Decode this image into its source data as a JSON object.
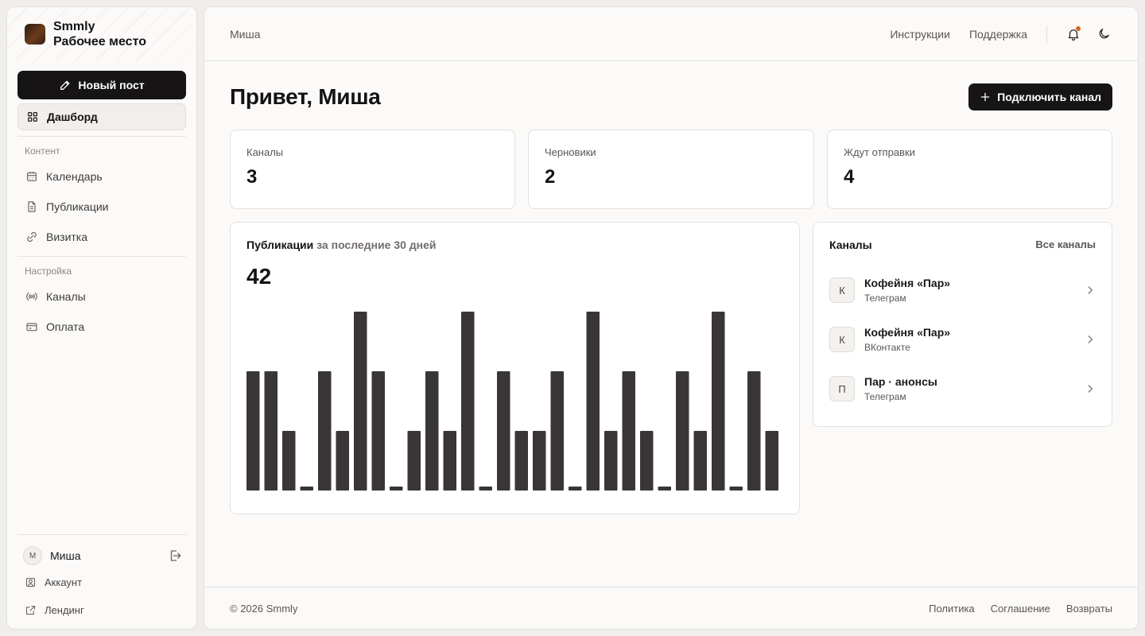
{
  "sidebar": {
    "brand_name": "Smmly",
    "brand_sub": "Рабочее место",
    "new_post": "Новый пост",
    "dashboard": "Дашборд",
    "section_content": "Контент",
    "calendar": "Календарь",
    "publications": "Публикации",
    "card": "Визитка",
    "section_settings": "Настройка",
    "channels": "Каналы",
    "payment": "Оплата",
    "user_initial": "М",
    "user_name": "Миша",
    "account": "Аккаунт",
    "landing": "Лендинг"
  },
  "topbar": {
    "breadcrumb": "Миша",
    "instructions": "Инструкции",
    "support": "Поддержка"
  },
  "main": {
    "greeting": "Привет, Миша",
    "connect_channel": "Подключить канал",
    "stats": [
      {
        "label": "Каналы",
        "value": "3"
      },
      {
        "label": "Черновики",
        "value": "2"
      },
      {
        "label": "Ждут отправки",
        "value": "4"
      }
    ],
    "chart_title": "Публикации",
    "chart_subtitle": "за последние 30 дней",
    "chart_total": "42",
    "channels_title": "Каналы",
    "all_channels": "Все каналы",
    "channels": [
      {
        "initial": "К",
        "name": "Кофейня «Пар»",
        "network": "Телеграм"
      },
      {
        "initial": "К",
        "name": "Кофейня «Пар»",
        "network": "ВКонтакте"
      },
      {
        "initial": "П",
        "name": "Пар · анонсы",
        "network": "Телеграм"
      }
    ]
  },
  "chart_data": {
    "type": "bar",
    "values": [
      2,
      2,
      1,
      0,
      2,
      1,
      3,
      2,
      0,
      1,
      2,
      1,
      3,
      0,
      2,
      1,
      1,
      2,
      0,
      3,
      1,
      2,
      1,
      0,
      2,
      1,
      3,
      0,
      2,
      1
    ],
    "ylim": [
      0,
      3
    ],
    "grid": false,
    "color": "#3a3636"
  },
  "footer": {
    "copyright": "© 2026 Smmly",
    "policy": "Политика",
    "agreement": "Соглашение",
    "refunds": "Возвраты"
  }
}
